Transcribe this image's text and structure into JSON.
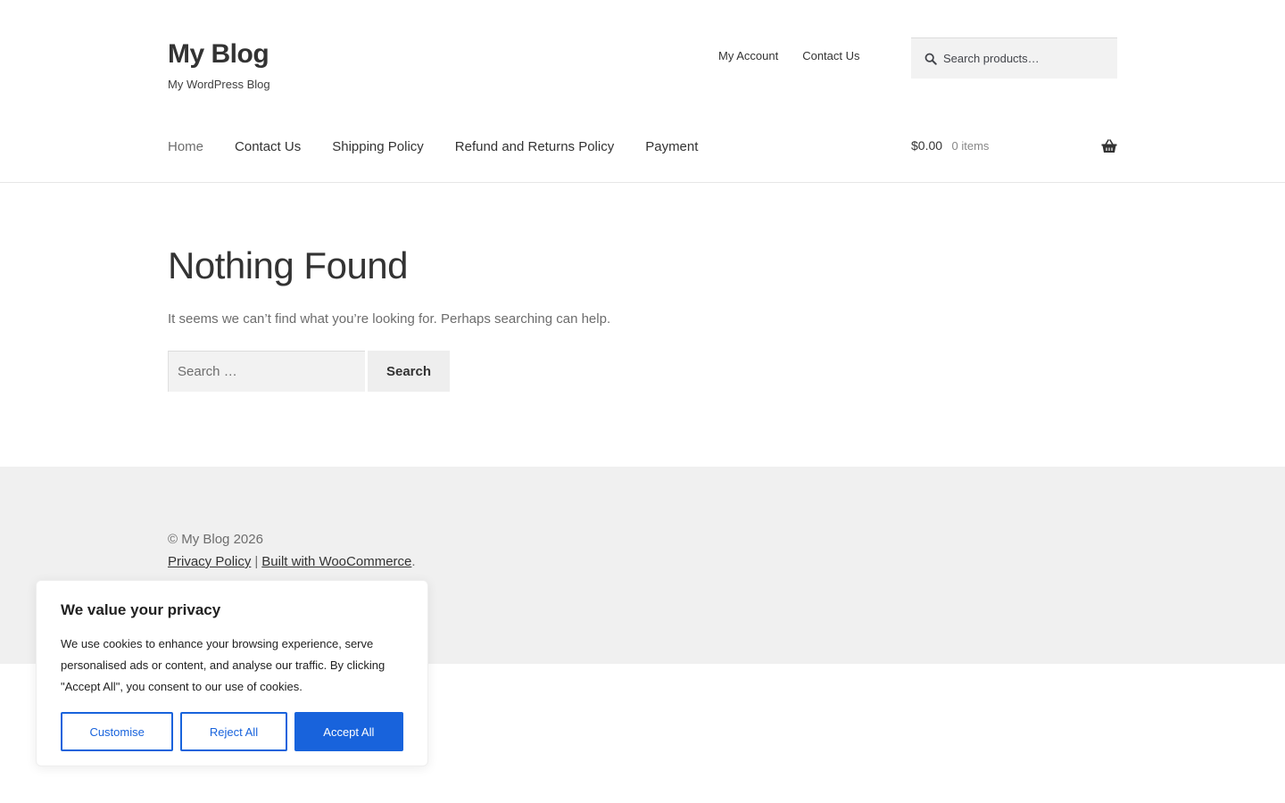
{
  "site": {
    "title": "My Blog",
    "description": "My WordPress Blog"
  },
  "secondary_nav": {
    "items": [
      {
        "label": "My Account"
      },
      {
        "label": "Contact Us"
      }
    ]
  },
  "product_search": {
    "placeholder": "Search products…",
    "icon": "search-icon"
  },
  "primary_nav": {
    "items": [
      {
        "label": "Home",
        "current": true
      },
      {
        "label": "Contact Us"
      },
      {
        "label": "Shipping Policy"
      },
      {
        "label": "Refund and Returns Policy"
      },
      {
        "label": "Payment"
      }
    ]
  },
  "cart": {
    "amount": "$0.00",
    "count": "0 items",
    "icon": "basket-icon"
  },
  "main": {
    "title": "Nothing Found",
    "message": "It seems we can’t find what you’re looking for. Perhaps searching can help.",
    "search_placeholder": "Search …",
    "search_button": "Search"
  },
  "footer": {
    "copyright": "© My Blog 2026",
    "privacy_link": "Privacy Policy",
    "separator": "|",
    "built_with_link": "Built with WooCommerce",
    "trailing": "."
  },
  "cookie": {
    "title": "We value your privacy",
    "text": "We use cookies to enhance your browsing experience, serve personalised ads or content, and analyse our traffic. By clicking \"Accept All\", you consent to our use of cookies.",
    "customise": "Customise",
    "reject": "Reject All",
    "accept": "Accept All"
  },
  "colors": {
    "accent": "#1863dc",
    "footer_bg": "#f0f0f0",
    "input_bg": "#f2f2f2"
  }
}
